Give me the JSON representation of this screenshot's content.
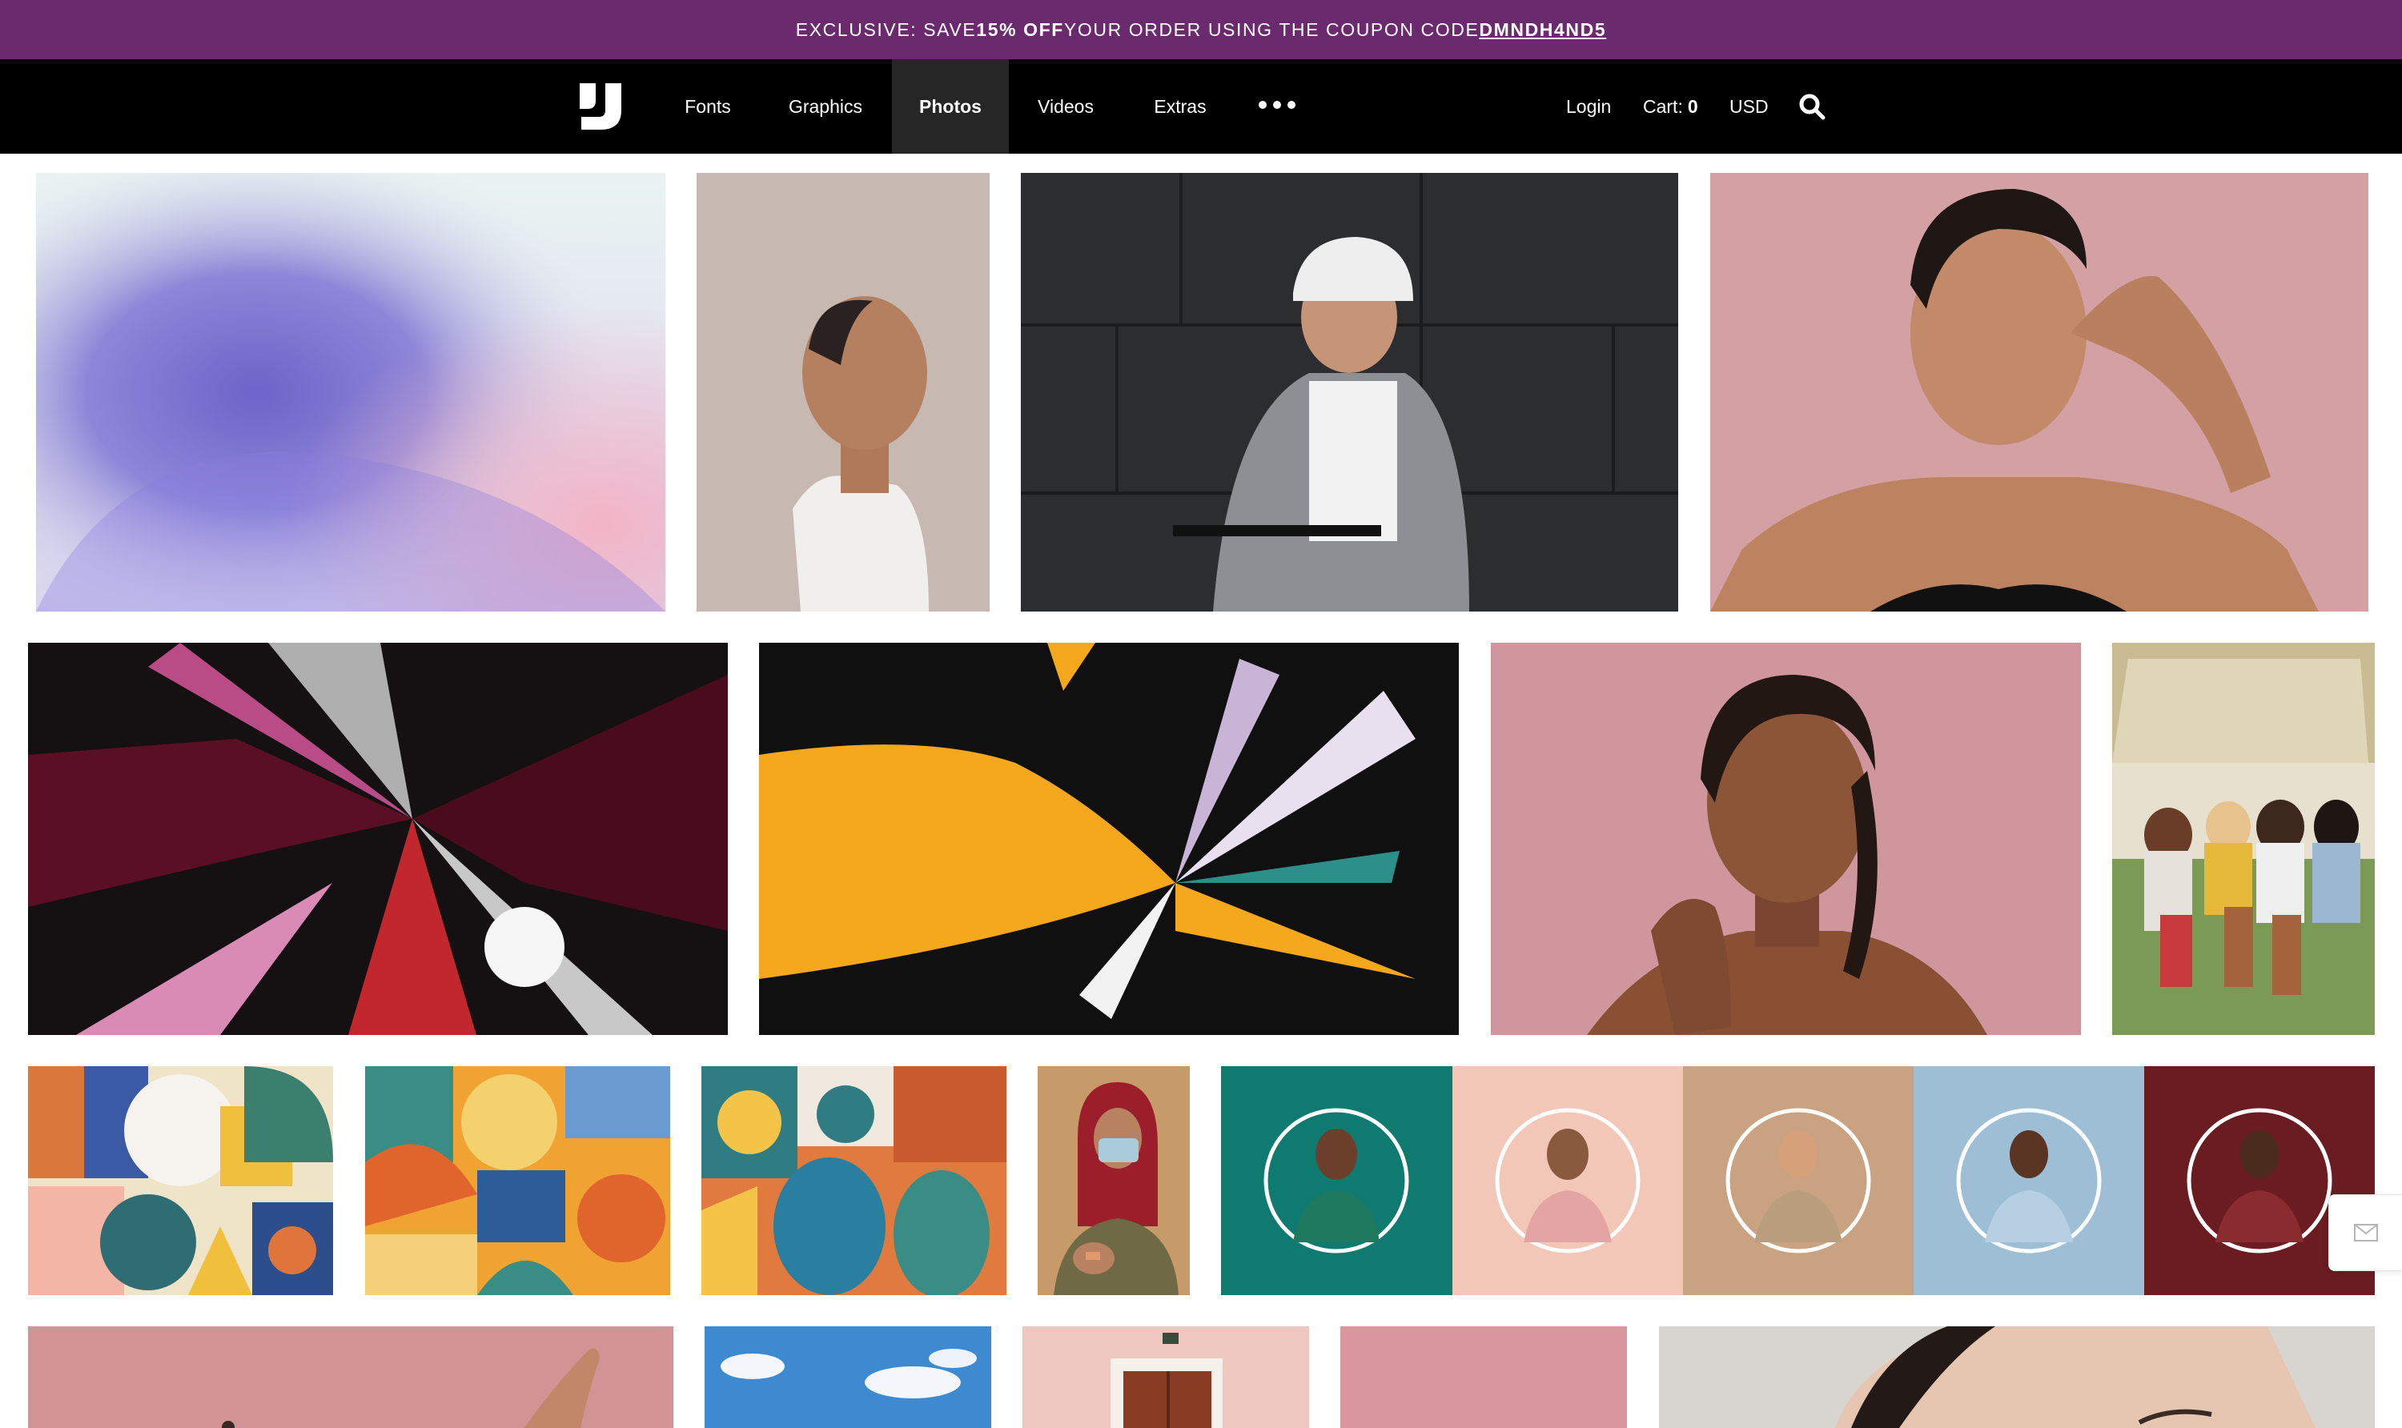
{
  "promo": {
    "prefix": "EXCLUSIVE: SAVE ",
    "discount": "15% OFF",
    "middle": " YOUR ORDER USING THE COUPON CODE ",
    "code": "DMNDH4ND5"
  },
  "nav": {
    "items": [
      {
        "label": "Fonts"
      },
      {
        "label": "Graphics"
      },
      {
        "label": "Photos",
        "active": true
      },
      {
        "label": "Videos"
      },
      {
        "label": "Extras"
      }
    ],
    "more_icon": "more-dots-icon",
    "login": "Login",
    "cart_label": "Cart:",
    "cart_count": "0",
    "currency": "USD",
    "search_icon": "search-icon",
    "logo_icon": "brand-logo-icon"
  },
  "colors": {
    "promo_bg": "#6b2a6e",
    "nav_bg": "#000000",
    "nav_active_bg": "#262626"
  },
  "gallery": {
    "rows": [
      [
        "gradient-abstract",
        "profile-portrait",
        "helmet-scooter-woman",
        "skincare-woman-pink"
      ],
      [
        "glitch-abstract-dark",
        "glitch-abstract-yellow",
        "braided-hair-woman",
        "friends-car-trunk"
      ],
      [
        "geometric-pattern-1",
        "geometric-pattern-2",
        "geometric-pattern-3",
        "vaccinated-woman",
        "portrait-circles-collage"
      ],
      [
        "pink-hand",
        "blue-sky",
        "doorway-pink-wall",
        "pink-plain",
        "woman-closeup"
      ]
    ]
  },
  "feedback_icon": "mail-icon"
}
